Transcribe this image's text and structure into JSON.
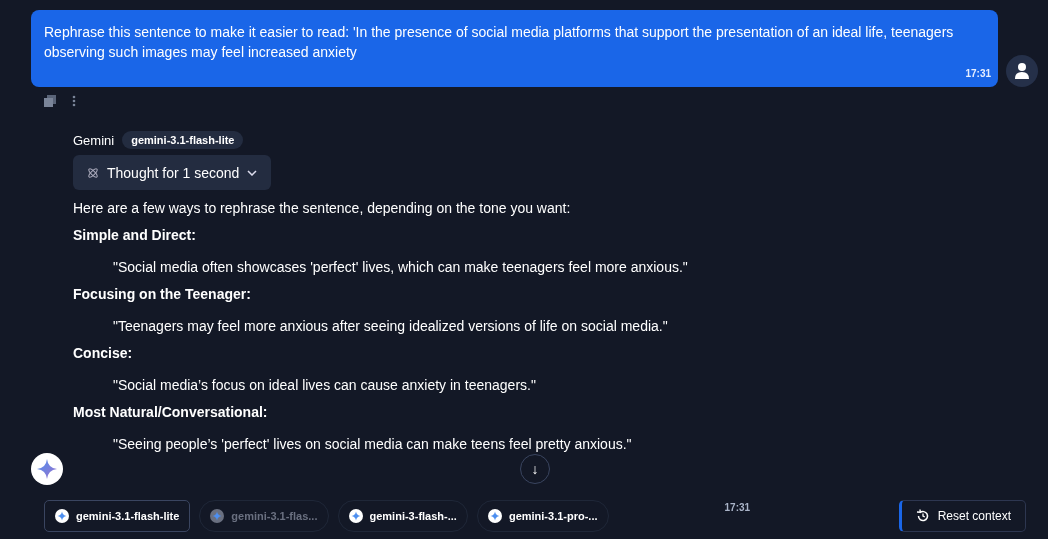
{
  "user_message": {
    "text": "Rephrase this sentence to make it easier to read: 'In the presence of social media platforms that support the presentation of an ideal life, teenagers observing such images may feel increased anxiety",
    "time": "17:31"
  },
  "assistant": {
    "name": "Gemini",
    "model": "gemini-3.1-flash-lite",
    "thought": {
      "label": "Thought for 1 second",
      "expanded": false
    },
    "intro": "Here are a few ways to rephrase the sentence, depending on the tone you want:",
    "sections": [
      {
        "heading": "Simple and Direct:",
        "quote": "\"Social media often showcases 'perfect' lives, which can make teenagers feel more anxious.\""
      },
      {
        "heading": "Focusing on the Teenager:",
        "quote": "\"Teenagers may feel more anxious after seeing idealized versions of life on social media.\""
      },
      {
        "heading": "Concise:",
        "quote": "\"Social media’s focus on ideal lives can cause anxiety in teenagers.\""
      },
      {
        "heading": "Most Natural/Conversational:",
        "quote": "\"Seeing people’s 'perfect' lives on social media can make teens feel pretty anxious.\""
      }
    ]
  },
  "scroll_down": {
    "label": "↓"
  },
  "models": [
    {
      "label": "gemini-3.1-flash-lite",
      "selected": true,
      "disabled": false
    },
    {
      "label": "gemini-3.1-flas...",
      "selected": false,
      "disabled": true
    },
    {
      "label": "gemini-3-flash-...",
      "selected": false,
      "disabled": false
    },
    {
      "label": "gemini-3.1-pro-...",
      "selected": false,
      "disabled": false
    }
  ],
  "bottom_time": "17:31",
  "reset_button": {
    "label": "Reset context"
  }
}
